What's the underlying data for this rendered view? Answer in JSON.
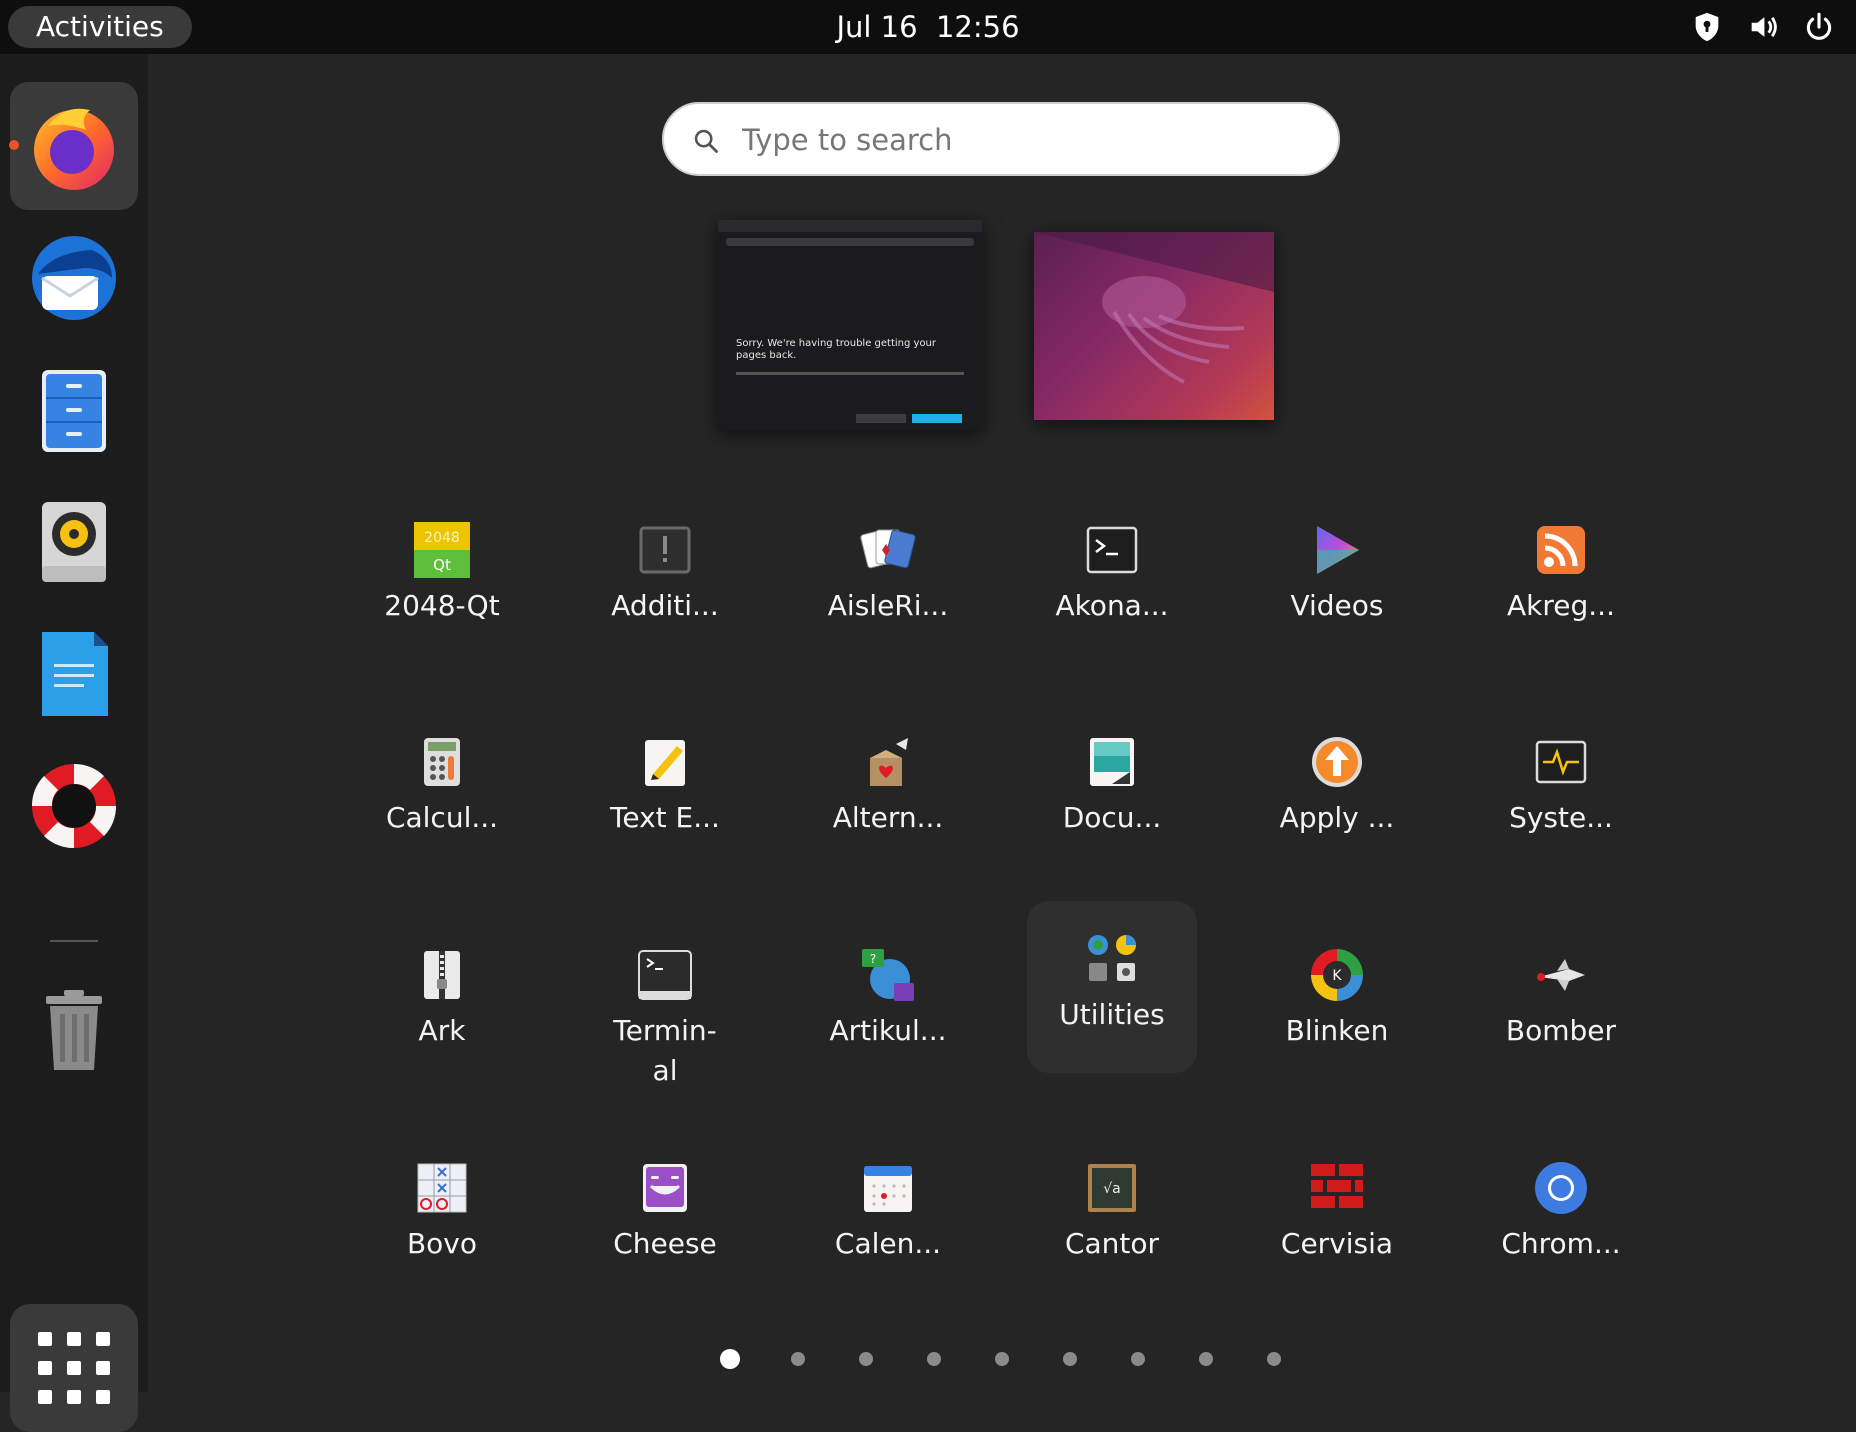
{
  "topbar": {
    "activities_label": "Activities",
    "date": "Jul 16",
    "time": "12:56",
    "tray_icons": [
      "shield-icon",
      "volume-icon",
      "power-icon"
    ]
  },
  "dash": {
    "items": [
      {
        "name": "firefox",
        "icon": "firefox-icon",
        "running": true
      },
      {
        "name": "thunderbird",
        "icon": "thunderbird-icon"
      },
      {
        "name": "files",
        "icon": "files-icon"
      },
      {
        "name": "rhythmbox",
        "icon": "rhythmbox-icon"
      },
      {
        "name": "writer",
        "icon": "writer-icon"
      },
      {
        "name": "help",
        "icon": "help-icon"
      },
      {
        "name": "trash",
        "icon": "trash-icon"
      }
    ],
    "show_apps_icon": "app-grid-icon"
  },
  "search": {
    "placeholder": "Type to search",
    "value": ""
  },
  "workspaces": {
    "firefox_message": "Sorry. We're having trouble getting your pages back."
  },
  "apps": [
    {
      "label": "2048-Qt",
      "icon": "2048-icon"
    },
    {
      "label": "Additi...",
      "icon": "additional-drivers-icon"
    },
    {
      "label": "AisleRi...",
      "icon": "cards-icon"
    },
    {
      "label": "Akona...",
      "icon": "terminal-icon"
    },
    {
      "label": "Videos",
      "icon": "videos-icon"
    },
    {
      "label": "Akreg...",
      "icon": "rss-icon"
    },
    {
      "label": "Calcul...",
      "icon": "calculator-icon"
    },
    {
      "label": "Text E...",
      "icon": "text-editor-icon"
    },
    {
      "label": "Altern...",
      "icon": "alternatives-icon"
    },
    {
      "label": "Docu...",
      "icon": "document-viewer-icon"
    },
    {
      "label": "Apply ...",
      "icon": "apply-updates-icon"
    },
    {
      "label": "Syste...",
      "icon": "system-monitor-icon"
    },
    {
      "label": "Ark",
      "icon": "archive-icon"
    },
    {
      "label": "Termin-al",
      "icon": "terminal-icon"
    },
    {
      "label": "Artikul...",
      "icon": "artikulate-icon"
    },
    {
      "label": "Utilities",
      "icon": "folder-utilities-icon"
    },
    {
      "label": "Blinken",
      "icon": "blinken-icon"
    },
    {
      "label": "Bomber",
      "icon": "bomber-icon"
    },
    {
      "label": "Bovo",
      "icon": "bovo-icon"
    },
    {
      "label": "Cheese",
      "icon": "cheese-icon"
    },
    {
      "label": "Calen...",
      "icon": "calendar-icon"
    },
    {
      "label": "Cantor",
      "icon": "cantor-icon"
    },
    {
      "label": "Cervisia",
      "icon": "cervisia-icon"
    },
    {
      "label": "Chrom...",
      "icon": "chromium-icon"
    }
  ],
  "pager": {
    "pages": 9,
    "current": 1
  },
  "colors": {
    "accent": "#e95420",
    "panel": "#0e0e0e",
    "background": "#252525"
  }
}
